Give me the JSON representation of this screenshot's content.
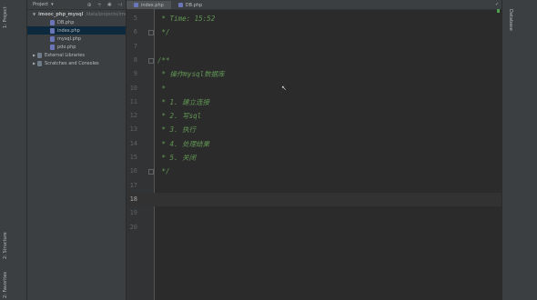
{
  "left_strip": {
    "project_tab": "1: Project",
    "structure_tab": "2: Structure",
    "favorites_tab": "2: Favorites"
  },
  "right_strip": {
    "database_tab": "Database"
  },
  "project_panel": {
    "title": "Project",
    "tree": [
      {
        "label": "imooc_php_mysql",
        "path": "/data/projects/imooc",
        "depth": 0,
        "type": "folder",
        "expanded": true
      },
      {
        "label": "DB.php",
        "depth": 1,
        "type": "php"
      },
      {
        "label": "index.php",
        "depth": 1,
        "type": "php",
        "selected": true
      },
      {
        "label": "mysql.php",
        "depth": 1,
        "type": "php"
      },
      {
        "label": "pdo.php",
        "depth": 1,
        "type": "php"
      },
      {
        "label": "External Libraries",
        "depth": 0,
        "type": "lib",
        "expanded": false
      },
      {
        "label": "Scratches and Consoles",
        "depth": 0,
        "type": "lib",
        "expanded": false
      }
    ]
  },
  "editor": {
    "tabs": [
      {
        "label": "index.php",
        "active": true
      },
      {
        "label": "DB.php",
        "active": false
      }
    ],
    "lines": [
      {
        "n": "5",
        "text": " * Time: 15:52"
      },
      {
        "n": "6",
        "text": " */"
      },
      {
        "n": "7",
        "text": ""
      },
      {
        "n": "8",
        "text": "/**"
      },
      {
        "n": "9",
        "text": " * 操作mysql数据库"
      },
      {
        "n": "10",
        "text": " *"
      },
      {
        "n": "11",
        "text": " * 1. 建立连接"
      },
      {
        "n": "12",
        "text": " * 2. 写sql"
      },
      {
        "n": "13",
        "text": " * 3. 执行"
      },
      {
        "n": "14",
        "text": " * 4. 处理结果"
      },
      {
        "n": "15",
        "text": " * 5. 关闭"
      },
      {
        "n": "16",
        "text": " */"
      },
      {
        "n": "17",
        "text": ""
      },
      {
        "n": "18",
        "text": "",
        "current": true
      },
      {
        "n": "19",
        "text": ""
      },
      {
        "n": "20",
        "text": ""
      }
    ]
  },
  "colors": {
    "comment": "#629755",
    "background": "#2b2b2b",
    "panel": "#3c3f41",
    "selection": "#0d293e"
  }
}
